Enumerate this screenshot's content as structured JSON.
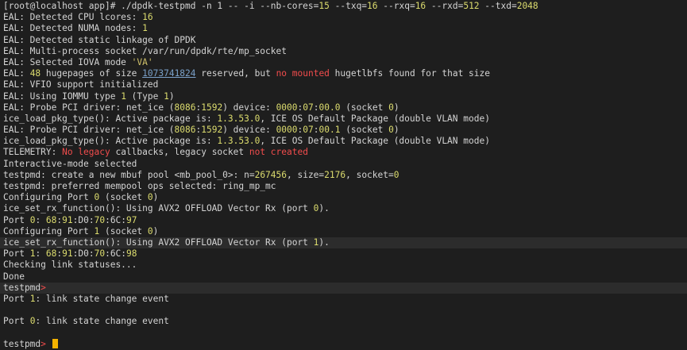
{
  "window": {
    "title": ""
  },
  "colors": {
    "background": "#1e1e1e",
    "text": "#d4d4d4",
    "number": "#dcdc6e",
    "error": "#f14c4c",
    "cursor": "#f5b300"
  },
  "terminal": {
    "lines": [
      {
        "hl": false,
        "segs": [
          [
            "default",
            "[root@localhost app]# ./dpdk-testpmd -n 1 -- -i --nb-cores="
          ],
          [
            "num",
            "15"
          ],
          [
            "default",
            " --txq="
          ],
          [
            "num",
            "16"
          ],
          [
            "default",
            " --rxq="
          ],
          [
            "num",
            "16"
          ],
          [
            "default",
            " --rxd="
          ],
          [
            "num",
            "512"
          ],
          [
            "default",
            " --txd="
          ],
          [
            "num",
            "2048"
          ]
        ]
      },
      {
        "hl": false,
        "segs": [
          [
            "default",
            "EAL: Detected CPU lcores: "
          ],
          [
            "num",
            "16"
          ]
        ]
      },
      {
        "hl": false,
        "segs": [
          [
            "default",
            "EAL: Detected NUMA nodes: "
          ],
          [
            "num",
            "1"
          ]
        ]
      },
      {
        "hl": false,
        "segs": [
          [
            "default",
            "EAL: Detected static linkage of DPDK"
          ]
        ]
      },
      {
        "hl": false,
        "segs": [
          [
            "default",
            "EAL: Multi-process socket /var/run/dpdk/rte/mp_socket"
          ]
        ]
      },
      {
        "hl": false,
        "segs": [
          [
            "default",
            "EAL: Selected IOVA mode "
          ],
          [
            "str",
            "'VA'"
          ]
        ]
      },
      {
        "hl": false,
        "segs": [
          [
            "default",
            "EAL: "
          ],
          [
            "num",
            "48"
          ],
          [
            "default",
            " hugepages of size "
          ],
          [
            "link",
            "1073741824"
          ],
          [
            "default",
            " reserved, but "
          ],
          [
            "bad",
            "no mounted"
          ],
          [
            "default",
            " hugetlbfs found for that size"
          ]
        ]
      },
      {
        "hl": false,
        "segs": [
          [
            "default",
            "EAL: VFIO support initialized"
          ]
        ]
      },
      {
        "hl": false,
        "segs": [
          [
            "default",
            "EAL: Using IOMMU type "
          ],
          [
            "num",
            "1"
          ],
          [
            "default",
            " (Type "
          ],
          [
            "num",
            "1"
          ],
          [
            "default",
            ")"
          ]
        ]
      },
      {
        "hl": false,
        "segs": [
          [
            "default",
            "EAL: Probe PCI driver: net_ice ("
          ],
          [
            "num",
            "8086"
          ],
          [
            "default",
            ":"
          ],
          [
            "num",
            "1592"
          ],
          [
            "default",
            ") device: "
          ],
          [
            "num",
            "0000"
          ],
          [
            "default",
            ":"
          ],
          [
            "num",
            "07"
          ],
          [
            "default",
            ":"
          ],
          [
            "num",
            "00.0"
          ],
          [
            "default",
            " (socket "
          ],
          [
            "num",
            "0"
          ],
          [
            "default",
            ")"
          ]
        ]
      },
      {
        "hl": false,
        "segs": [
          [
            "default",
            "ice_load_pkg_type(): Active package is: "
          ],
          [
            "num",
            "1.3.53.0"
          ],
          [
            "default",
            ", ICE OS Default Package (double VLAN mode)"
          ]
        ]
      },
      {
        "hl": false,
        "segs": [
          [
            "default",
            "EAL: Probe PCI driver: net_ice ("
          ],
          [
            "num",
            "8086"
          ],
          [
            "default",
            ":"
          ],
          [
            "num",
            "1592"
          ],
          [
            "default",
            ") device: "
          ],
          [
            "num",
            "0000"
          ],
          [
            "default",
            ":"
          ],
          [
            "num",
            "07"
          ],
          [
            "default",
            ":"
          ],
          [
            "num",
            "00.1"
          ],
          [
            "default",
            " (socket "
          ],
          [
            "num",
            "0"
          ],
          [
            "default",
            ")"
          ]
        ]
      },
      {
        "hl": false,
        "segs": [
          [
            "default",
            "ice_load_pkg_type(): Active package is: "
          ],
          [
            "num",
            "1.3.53.0"
          ],
          [
            "default",
            ", ICE OS Default Package (double VLAN mode)"
          ]
        ]
      },
      {
        "hl": false,
        "segs": [
          [
            "default",
            "TELEMETRY: "
          ],
          [
            "bad",
            "No legacy"
          ],
          [
            "default",
            " callbacks, legacy socket "
          ],
          [
            "bad",
            "not created"
          ]
        ]
      },
      {
        "hl": false,
        "segs": [
          [
            "default",
            "Interactive-mode selected"
          ]
        ]
      },
      {
        "hl": false,
        "segs": [
          [
            "default",
            "testpmd: create a new mbuf pool <mb_pool_0>: n="
          ],
          [
            "num",
            "267456"
          ],
          [
            "default",
            ", size="
          ],
          [
            "num",
            "2176"
          ],
          [
            "default",
            ", socket="
          ],
          [
            "num",
            "0"
          ]
        ]
      },
      {
        "hl": false,
        "segs": [
          [
            "default",
            "testpmd: preferred mempool ops selected: ring_mp_mc"
          ]
        ]
      },
      {
        "hl": false,
        "segs": [
          [
            "default",
            "Configuring Port "
          ],
          [
            "num",
            "0"
          ],
          [
            "default",
            " (socket "
          ],
          [
            "num",
            "0"
          ],
          [
            "default",
            ")"
          ]
        ]
      },
      {
        "hl": false,
        "segs": [
          [
            "default",
            "ice_set_rx_function(): Using AVX2 OFFLOAD Vector Rx (port "
          ],
          [
            "num",
            "0"
          ],
          [
            "default",
            ")."
          ]
        ]
      },
      {
        "hl": false,
        "segs": [
          [
            "default",
            "Port "
          ],
          [
            "num",
            "0"
          ],
          [
            "default",
            ": "
          ],
          [
            "num",
            "68"
          ],
          [
            "default",
            ":"
          ],
          [
            "num",
            "91"
          ],
          [
            "default",
            ":D0:"
          ],
          [
            "num",
            "70"
          ],
          [
            "default",
            ":6C:"
          ],
          [
            "num",
            "97"
          ]
        ]
      },
      {
        "hl": false,
        "segs": [
          [
            "default",
            "Configuring Port "
          ],
          [
            "num",
            "1"
          ],
          [
            "default",
            " (socket "
          ],
          [
            "num",
            "0"
          ],
          [
            "default",
            ")"
          ]
        ]
      },
      {
        "hl": true,
        "segs": [
          [
            "default",
            "ice_set_rx_function(): Using AVX2 OFFLOAD Vector Rx (port "
          ],
          [
            "num",
            "1"
          ],
          [
            "default",
            ")."
          ]
        ]
      },
      {
        "hl": false,
        "segs": [
          [
            "default",
            "Port "
          ],
          [
            "num",
            "1"
          ],
          [
            "default",
            ": "
          ],
          [
            "num",
            "68"
          ],
          [
            "default",
            ":"
          ],
          [
            "num",
            "91"
          ],
          [
            "default",
            ":D0:"
          ],
          [
            "num",
            "70"
          ],
          [
            "default",
            ":6C:"
          ],
          [
            "num",
            "98"
          ]
        ]
      },
      {
        "hl": false,
        "segs": [
          [
            "default",
            "Checking link statuses..."
          ]
        ]
      },
      {
        "hl": false,
        "segs": [
          [
            "default",
            "Done"
          ]
        ]
      },
      {
        "hl": true,
        "segs": [
          [
            "prompt",
            "testpmd"
          ],
          [
            "promptsym",
            ">"
          ]
        ]
      },
      {
        "hl": false,
        "segs": [
          [
            "default",
            "Port "
          ],
          [
            "num",
            "1"
          ],
          [
            "default",
            ": link state change event"
          ]
        ]
      },
      {
        "hl": false,
        "segs": []
      },
      {
        "hl": false,
        "segs": [
          [
            "default",
            "Port "
          ],
          [
            "num",
            "0"
          ],
          [
            "default",
            ": link state change event"
          ]
        ]
      },
      {
        "hl": false,
        "segs": []
      },
      {
        "hl": false,
        "cursor": true,
        "segs": [
          [
            "prompt",
            "testpmd"
          ],
          [
            "promptsym",
            "> "
          ]
        ]
      }
    ]
  }
}
